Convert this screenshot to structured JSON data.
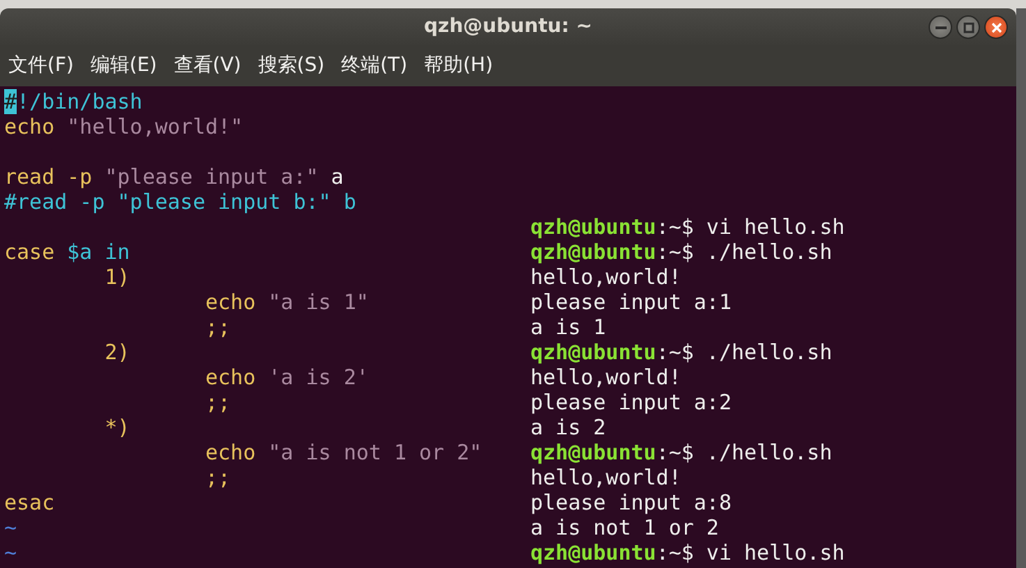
{
  "window": {
    "title": "qzh@ubuntu: ~",
    "controls": [
      {
        "kind": "minimize"
      },
      {
        "kind": "maximize"
      },
      {
        "kind": "close"
      }
    ]
  },
  "menu": [
    "文件(F)",
    "编辑(E)",
    "查看(V)",
    "搜索(S)",
    "终端(T)",
    "帮助(H)"
  ],
  "editor_lines": [
    {
      "kind": "code",
      "segments": [
        {
          "text": "#",
          "kind": "cursor"
        },
        {
          "text": "!/bin/bash",
          "kind": "comment"
        }
      ]
    },
    {
      "kind": "code",
      "segments": [
        {
          "text": "echo ",
          "kind": "keyword"
        },
        {
          "text": "\"hello,world!\"",
          "kind": "string"
        }
      ]
    },
    {
      "kind": "blank"
    },
    {
      "kind": "code",
      "segments": [
        {
          "text": "read -p ",
          "kind": "keyword"
        },
        {
          "text": "\"please input a:\"",
          "kind": "string"
        },
        {
          "text": " a",
          "kind": "plain"
        }
      ]
    },
    {
      "kind": "code",
      "segments": [
        {
          "text": "#read -p \"please input b:\" b",
          "kind": "comment"
        }
      ]
    },
    {
      "kind": "blank"
    },
    {
      "kind": "code",
      "segments": [
        {
          "text": "case ",
          "kind": "keyword"
        },
        {
          "text": "$a in",
          "kind": "comment"
        }
      ]
    },
    {
      "kind": "code",
      "segments": [
        {
          "text": "        1)",
          "kind": "keyword"
        }
      ]
    },
    {
      "kind": "code",
      "segments": [
        {
          "text": "                echo ",
          "kind": "keyword"
        },
        {
          "text": "\"a is 1\"",
          "kind": "string"
        }
      ]
    },
    {
      "kind": "code",
      "segments": [
        {
          "text": "                ;;",
          "kind": "keyword"
        }
      ]
    },
    {
      "kind": "code",
      "segments": [
        {
          "text": "        2)",
          "kind": "keyword"
        }
      ]
    },
    {
      "kind": "code",
      "segments": [
        {
          "text": "                echo ",
          "kind": "keyword"
        },
        {
          "text": "'a is 2'",
          "kind": "string"
        }
      ]
    },
    {
      "kind": "code",
      "segments": [
        {
          "text": "                ;;",
          "kind": "keyword"
        }
      ]
    },
    {
      "kind": "code",
      "segments": [
        {
          "text": "        *)",
          "kind": "keyword"
        }
      ]
    },
    {
      "kind": "code",
      "segments": [
        {
          "text": "                echo ",
          "kind": "keyword"
        },
        {
          "text": "\"a is not 1 or 2\"",
          "kind": "string"
        }
      ]
    },
    {
      "kind": "code",
      "segments": [
        {
          "text": "                ;;",
          "kind": "keyword"
        }
      ]
    },
    {
      "kind": "code",
      "segments": [
        {
          "text": "esac",
          "kind": "keyword"
        }
      ]
    },
    {
      "kind": "tilde",
      "text": "~"
    },
    {
      "kind": "tilde",
      "text": "~"
    }
  ],
  "terminal_lines": [
    {
      "kind": "prompt",
      "prompt": "qzh@ubuntu",
      "text": ":~$ vi hello.sh"
    },
    {
      "kind": "prompt",
      "prompt": "qzh@ubuntu",
      "text": ":~$ ./hello.sh"
    },
    {
      "kind": "output",
      "text": "hello,world!"
    },
    {
      "kind": "output",
      "text": "please input a:1"
    },
    {
      "kind": "output",
      "text": "a is 1"
    },
    {
      "kind": "prompt",
      "prompt": "qzh@ubuntu",
      "text": ":~$ ./hello.sh"
    },
    {
      "kind": "output",
      "text": "hello,world!"
    },
    {
      "kind": "output",
      "text": "please input a:2"
    },
    {
      "kind": "output",
      "text": "a is 2"
    },
    {
      "kind": "prompt",
      "prompt": "qzh@ubuntu",
      "text": ":~$ ./hello.sh"
    },
    {
      "kind": "output",
      "text": "hello,world!"
    },
    {
      "kind": "output",
      "text": "please input a:8"
    },
    {
      "kind": "output",
      "text": "a is not 1 or 2"
    },
    {
      "kind": "prompt",
      "prompt": "qzh@ubuntu",
      "text": ":~$ vi hello.sh"
    }
  ]
}
